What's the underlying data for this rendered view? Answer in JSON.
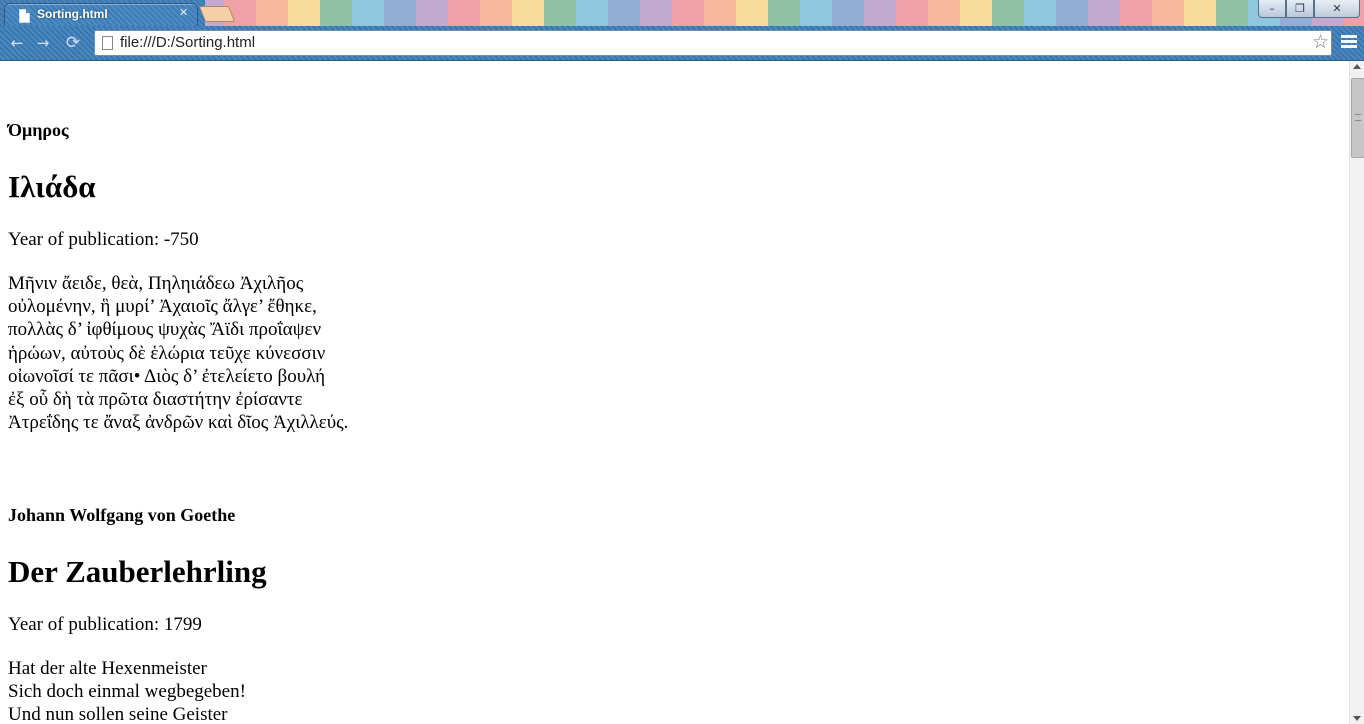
{
  "browser": {
    "tab_title": "Sorting.html",
    "tab_close": "✕",
    "url": "file:///D:/Sorting.html",
    "icons": {
      "back": "arrow-left",
      "forward": "arrow-right",
      "reload": "reload",
      "bookmark": "star",
      "menu": "hamburger"
    },
    "window_buttons": {
      "minimize": "–",
      "restore": "❐",
      "close": "✕"
    }
  },
  "books": [
    {
      "author": "Όμηρος",
      "title": "Ιλιάδα",
      "year_label": "Year of publication: -750",
      "lines": [
        "Μῆνιν ἄειδε, θεὰ, Πηληιάδεω Ἀχιλῆος",
        "οὐλομένην, ἣ μυρί’ Ἀχαιοῖς ἄλγε’ ἔθηκε,",
        "πολλὰς δ’ ἰφθίμους ψυχὰς Ἄϊδι προΐαψεν",
        "ἡρώων, αὐτοὺς δὲ ἑλώρια τεῦχε κύνεσσιν",
        "οἰωνοῖσί τε πᾶσι• Διὸς δ’ ἐτελείετο βουλή",
        "ἐξ οὗ δὴ τὰ πρῶτα διαστήτην ἐρίσαντε",
        "Ἀτρεΐδης τε ἄναξ ἀνδρῶν καὶ δῖος Ἀχιλλεύς."
      ]
    },
    {
      "author": "Johann Wolfgang von Goethe",
      "title": "Der Zauberlehrling",
      "year_label": "Year of publication: 1799",
      "lines": [
        "Hat der alte Hexenmeister",
        "Sich doch einmal wegbegeben!",
        "Und nun sollen seine Geister"
      ]
    }
  ]
}
